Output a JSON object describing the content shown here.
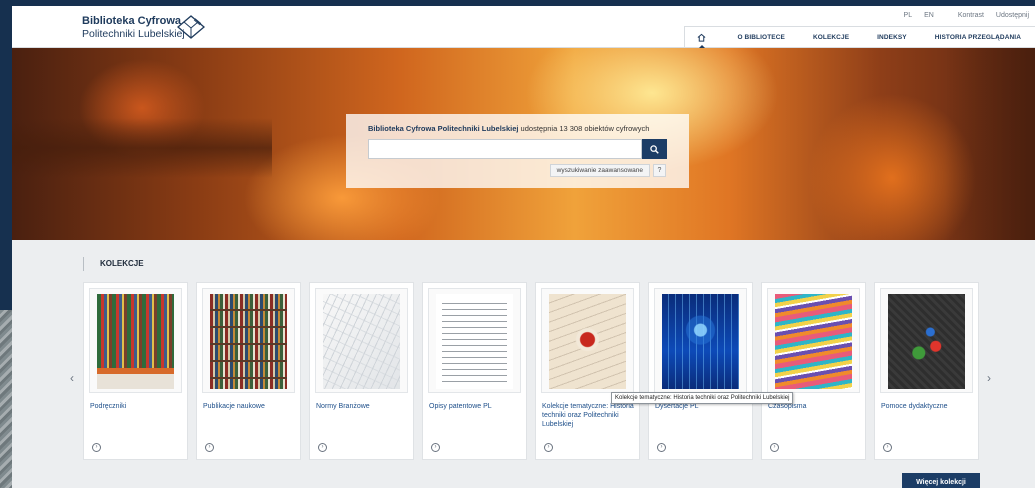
{
  "header": {
    "logo_line1": "Biblioteka Cyfrowa",
    "logo_line2": "Politechniki Lubelskiej",
    "utility": [
      "PL",
      "EN",
      "Kontrast",
      "Udostępnij"
    ],
    "nav": [
      "O BIBLIOTECE",
      "KOLEKCJE",
      "INDEKSY",
      "HISTORIA PRZEGLĄDANIA"
    ]
  },
  "search": {
    "caption_bold": "Biblioteka Cyfrowa Politechniki Lubelskiej",
    "caption_rest": " udostępnia 13 308 obiektów cyfrowych",
    "input_value": "",
    "advanced_label": "wyszukiwanie zaawansowane",
    "help_label": "?"
  },
  "collections": {
    "heading": "KOLEKCJE",
    "prev_arrow": "‹",
    "next_arrow": "›",
    "more_label": "Więcej kolekcji",
    "tooltip": "Kolekcje tematyczne: Historia techniki oraz Politechniki Lubelskiej",
    "items": [
      {
        "title": "Podręczniki",
        "thumb": "books1"
      },
      {
        "title": "Publikacje naukowe",
        "thumb": "books2"
      },
      {
        "title": "Normy Branżowe",
        "thumb": "norms"
      },
      {
        "title": "Opisy patentowe PL",
        "thumb": "patent"
      },
      {
        "title": "Kolekcje tematyczne: Historia techniki oraz Politechniki Lubelskiej",
        "thumb": "tematic"
      },
      {
        "title": "Dysertacje PL",
        "thumb": "diss"
      },
      {
        "title": "Czasopisma",
        "thumb": "journals"
      },
      {
        "title": "Pomoce dydaktyczne",
        "thumb": "teaching"
      }
    ]
  },
  "colors": {
    "brand_navy": "#1c3d66",
    "link_blue": "#1e4f8a"
  }
}
